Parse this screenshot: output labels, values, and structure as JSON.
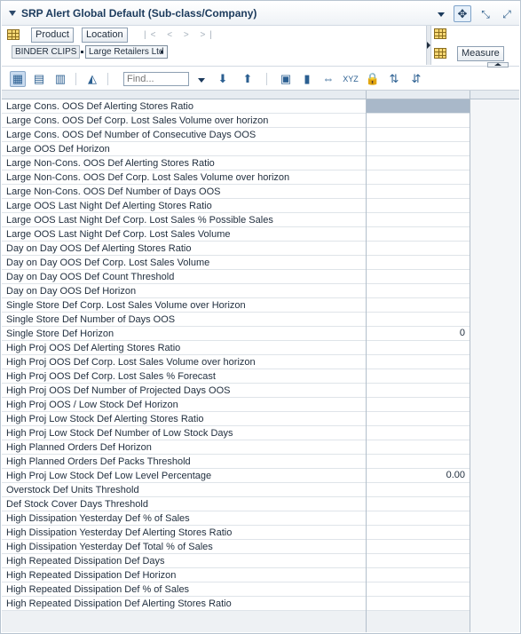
{
  "window": {
    "title": "SRP Alert Global Default (Sub-class/Company)",
    "icons": [
      "collapse-icon",
      "menu-icon",
      "move-icon",
      "shrink-icon",
      "maximize-icon"
    ]
  },
  "pivot": {
    "row_buttons": {
      "product": "Product",
      "location": "Location"
    },
    "members": {
      "product": "BINDER CLIPS",
      "location": "Large Retailers Ltd"
    },
    "measure_button": "Measure"
  },
  "toolbar": {
    "find_placeholder": "Find...",
    "tools": [
      "grid-view-icon",
      "chart-grid-icon",
      "chart-icon",
      "area-chart-icon",
      "find-icon",
      "move-down-icon",
      "move-up-icon",
      "spreadsheet-icon",
      "highlight-icon",
      "expand-icon",
      "xyz-icon",
      "lock-icon",
      "sort-ascending-icon",
      "sort-descending-icon"
    ]
  },
  "grid": {
    "rows": [
      {
        "label": "Large Cons. OOS Def Alerting Stores Ratio",
        "value": ""
      },
      {
        "label": "Large Cons. OOS Def Corp. Lost Sales Volume over horizon",
        "value": ""
      },
      {
        "label": "Large Cons. OOS Def Number of Consecutive Days OOS",
        "value": ""
      },
      {
        "label": "Large OOS Def Horizon",
        "value": ""
      },
      {
        "label": "Large Non-Cons. OOS Def Alerting Stores Ratio",
        "value": ""
      },
      {
        "label": "Large Non-Cons. OOS Def Corp. Lost Sales Volume over horizon",
        "value": ""
      },
      {
        "label": "Large Non-Cons. OOS Def Number of Days OOS",
        "value": ""
      },
      {
        "label": "Large OOS Last Night Def Alerting Stores Ratio",
        "value": ""
      },
      {
        "label": "Large OOS Last Night Def Corp. Lost Sales % Possible Sales",
        "value": ""
      },
      {
        "label": "Large OOS Last Night Def Corp. Lost Sales Volume",
        "value": ""
      },
      {
        "label": "Day on Day OOS Def Alerting Stores Ratio",
        "value": ""
      },
      {
        "label": "Day on Day OOS Def Corp. Lost Sales Volume",
        "value": ""
      },
      {
        "label": "Day on Day OOS Def Count Threshold",
        "value": ""
      },
      {
        "label": "Day on Day OOS Def Horizon",
        "value": ""
      },
      {
        "label": "Single Store Def Corp. Lost Sales Volume over Horizon",
        "value": ""
      },
      {
        "label": "Single Store Def Number of Days OOS",
        "value": ""
      },
      {
        "label": "Single Store Def Horizon",
        "value": "0"
      },
      {
        "label": "High Proj OOS Def Alerting Stores Ratio",
        "value": ""
      },
      {
        "label": "High Proj OOS Def Corp. Lost Sales Volume over horizon",
        "value": ""
      },
      {
        "label": "High Proj OOS Def Corp. Lost Sales % Forecast",
        "value": ""
      },
      {
        "label": "High Proj OOS Def Number of Projected Days OOS",
        "value": ""
      },
      {
        "label": "High Proj OOS / Low Stock Def Horizon",
        "value": ""
      },
      {
        "label": "High Proj Low Stock Def Alerting Stores Ratio",
        "value": ""
      },
      {
        "label": "High Proj Low Stock Def Number of Low Stock Days",
        "value": ""
      },
      {
        "label": "High Planned Orders Def Horizon",
        "value": ""
      },
      {
        "label": "High Planned Orders Def Packs Threshold",
        "value": ""
      },
      {
        "label": "High Proj Low Stock Def Low Level Percentage",
        "value": "0.00"
      },
      {
        "label": "Overstock Def Units Threshold",
        "value": ""
      },
      {
        "label": "Def Stock Cover Days Threshold",
        "value": ""
      },
      {
        "label": "High Dissipation Yesterday Def % of Sales",
        "value": ""
      },
      {
        "label": "High Dissipation Yesterday Def Alerting Stores Ratio",
        "value": ""
      },
      {
        "label": "High Dissipation Yesterday Def Total % of Sales",
        "value": ""
      },
      {
        "label": "High Repeated Dissipation Def Days",
        "value": ""
      },
      {
        "label": "High Repeated Dissipation Def Horizon",
        "value": ""
      },
      {
        "label": "High Repeated Dissipation Def % of Sales",
        "value": ""
      },
      {
        "label": "High Repeated Dissipation Def Alerting Stores Ratio",
        "value": ""
      }
    ]
  }
}
